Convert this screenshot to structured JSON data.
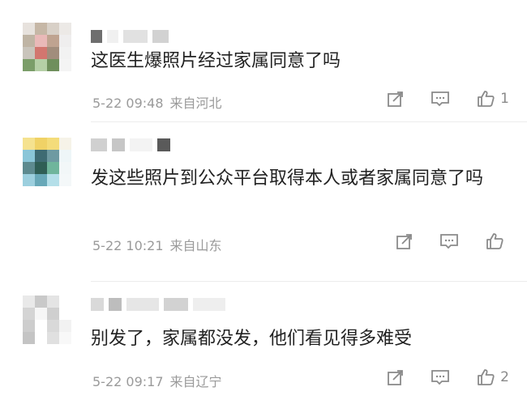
{
  "comments": [
    {
      "text": "这医生爆照片经过家属同意了吗",
      "date": "5-22 09:48",
      "location": "来自河北",
      "likes": "1"
    },
    {
      "text": "发这些照片到公众平台取得本人或者家属同意了吗",
      "date": "5-22 10:21",
      "location": "来自山东",
      "likes": ""
    },
    {
      "text": "别发了，家属都没发，他们看见得多难受",
      "date": "5-22 09:17",
      "location": "来自辽宁",
      "likes": "2"
    }
  ],
  "icons": {
    "share": "share-icon",
    "comment": "comment-icon",
    "like": "thumb-up-icon"
  },
  "colors": {
    "text": "#222222",
    "meta": "#9a9a9a",
    "icon": "#8a8a8a"
  }
}
